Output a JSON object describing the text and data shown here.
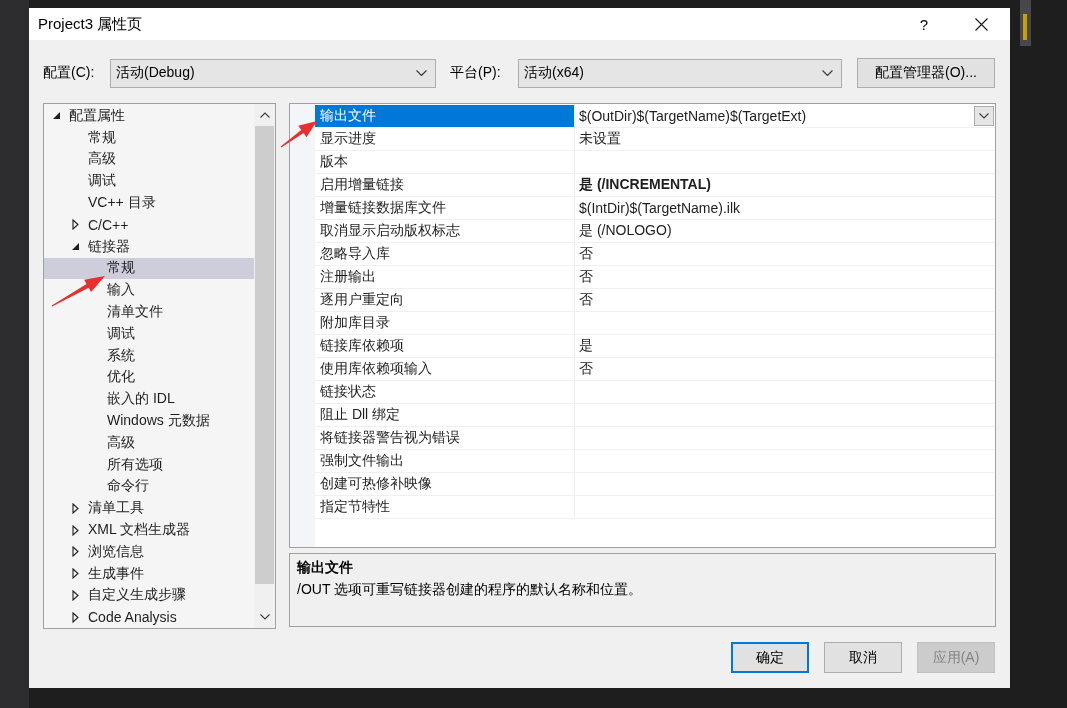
{
  "window": {
    "title": "Project3 属性页",
    "help_button": "?"
  },
  "config_bar": {
    "configuration_label": "配置(C):",
    "configuration_value": "活动(Debug)",
    "platform_label": "平台(P):",
    "platform_value": "活动(x64)",
    "manager_button": "配置管理器(O)..."
  },
  "tree": [
    {
      "label": "配置属性",
      "kind": "group",
      "expanded": true,
      "selected": false,
      "children": [
        {
          "label": "常规",
          "kind": "page",
          "selected": false
        },
        {
          "label": "高级",
          "kind": "page",
          "selected": false
        },
        {
          "label": "调试",
          "kind": "page",
          "selected": false
        },
        {
          "label": "VC++ 目录",
          "kind": "page",
          "selected": false
        },
        {
          "label": "C/C++",
          "kind": "group",
          "expanded": false,
          "selected": false
        },
        {
          "label": "链接器",
          "kind": "group",
          "expanded": true,
          "selected": false,
          "children": [
            {
              "label": "常规",
              "kind": "page",
              "selected": true
            },
            {
              "label": "输入",
              "kind": "page",
              "selected": false
            },
            {
              "label": "清单文件",
              "kind": "page",
              "selected": false
            },
            {
              "label": "调试",
              "kind": "page",
              "selected": false
            },
            {
              "label": "系统",
              "kind": "page",
              "selected": false
            },
            {
              "label": "优化",
              "kind": "page",
              "selected": false
            },
            {
              "label": "嵌入的 IDL",
              "kind": "page",
              "selected": false
            },
            {
              "label": "Windows 元数据",
              "kind": "page",
              "selected": false
            },
            {
              "label": "高级",
              "kind": "page",
              "selected": false
            },
            {
              "label": "所有选项",
              "kind": "page",
              "selected": false
            },
            {
              "label": "命令行",
              "kind": "page",
              "selected": false
            }
          ]
        },
        {
          "label": "清单工具",
          "kind": "group",
          "expanded": false,
          "selected": false
        },
        {
          "label": "XML 文档生成器",
          "kind": "group",
          "expanded": false,
          "selected": false
        },
        {
          "label": "浏览信息",
          "kind": "group",
          "expanded": false,
          "selected": false
        },
        {
          "label": "生成事件",
          "kind": "group",
          "expanded": false,
          "selected": false
        },
        {
          "label": "自定义生成步骤",
          "kind": "group",
          "expanded": false,
          "selected": false
        },
        {
          "label": "Code Analysis",
          "kind": "group",
          "expanded": false,
          "selected": false
        }
      ]
    }
  ],
  "properties": [
    {
      "name": "输出文件",
      "value": "$(OutDir)$(TargetName)$(TargetExt)",
      "non_default": false,
      "selected": true
    },
    {
      "name": "显示进度",
      "value": "未设置",
      "non_default": false,
      "selected": false
    },
    {
      "name": "版本",
      "selected": false
    },
    {
      "name": "启用增量链接",
      "value": "是 (/INCREMENTAL)",
      "non_default": true,
      "selected": false
    },
    {
      "name": "增量链接数据库文件",
      "value": "$(IntDir)$(TargetName).ilk",
      "non_default": false,
      "selected": false
    },
    {
      "name": "取消显示启动版权标志",
      "value": "是 (/NOLOGO)",
      "non_default": false,
      "selected": false
    },
    {
      "name": "忽略导入库",
      "value": "否",
      "non_default": false,
      "selected": false
    },
    {
      "name": "注册输出",
      "value": "否",
      "non_default": false,
      "selected": false
    },
    {
      "name": "逐用户重定向",
      "value": "否",
      "non_default": false,
      "selected": false
    },
    {
      "name": "附加库目录",
      "selected": false
    },
    {
      "name": "链接库依赖项",
      "value": "是",
      "non_default": false,
      "selected": false
    },
    {
      "name": "使用库依赖项输入",
      "value": "否",
      "non_default": false,
      "selected": false
    },
    {
      "name": "链接状态",
      "selected": false
    },
    {
      "name": "阻止 Dll 绑定",
      "selected": false
    },
    {
      "name": "将链接器警告视为错误",
      "selected": false
    },
    {
      "name": "强制文件输出",
      "selected": false
    },
    {
      "name": "创建可热修补映像",
      "selected": false
    },
    {
      "name": "指定节特性",
      "selected": false
    }
  ],
  "description": {
    "title": "输出文件",
    "text": "/OUT 选项可重写链接器创建的程序的默认名称和位置。"
  },
  "buttons": [
    {
      "label": "确定",
      "default": true,
      "disabled": false
    },
    {
      "label": "取消",
      "default": false,
      "disabled": false
    },
    {
      "label": "应用(A)",
      "default": false,
      "disabled": true
    }
  ]
}
